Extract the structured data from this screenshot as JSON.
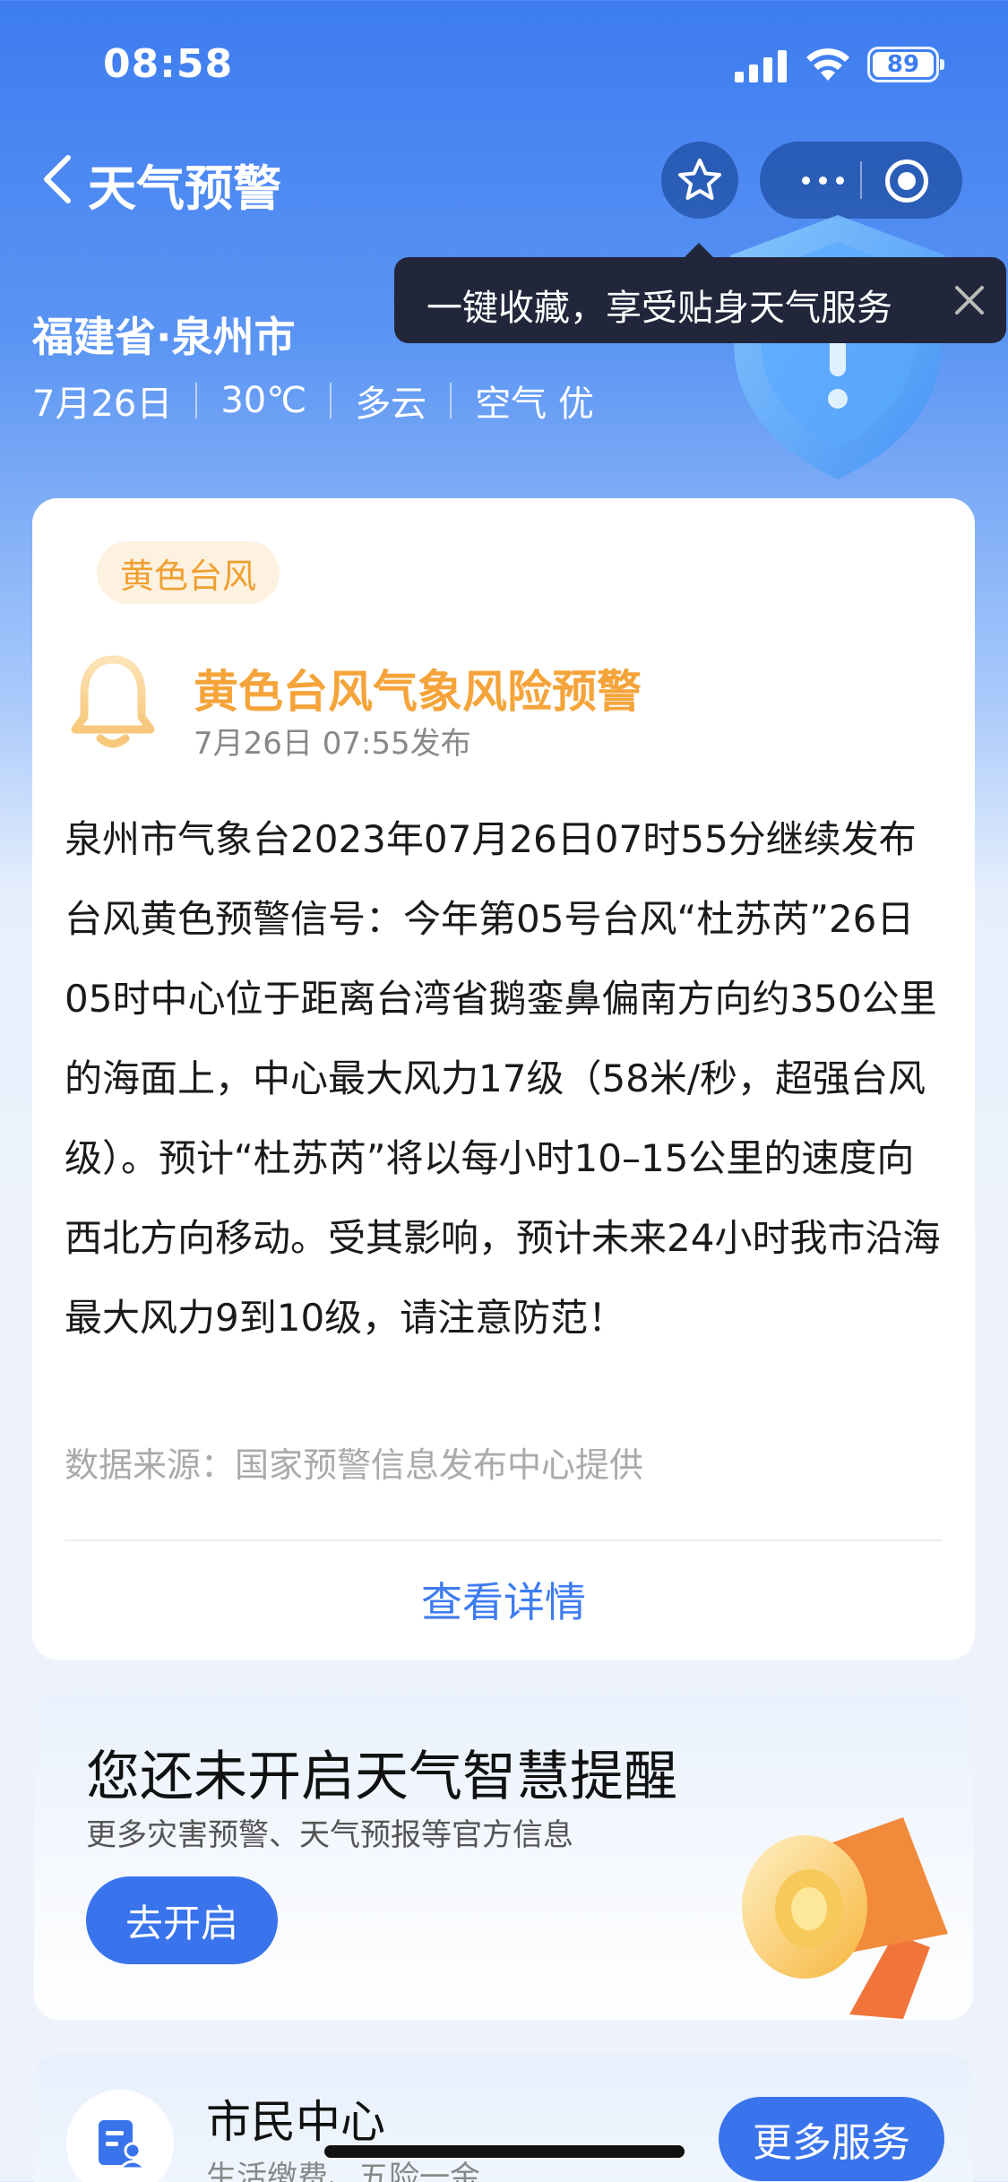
{
  "status_bar": {
    "time": "08:58",
    "battery_level": "89"
  },
  "nav": {
    "title": "天气预警"
  },
  "tooltip": {
    "text": "一键收藏，享受贴身天气服务"
  },
  "location": {
    "city": "福建省·泉州市",
    "date": "7月26日",
    "temperature": "30℃",
    "condition": "多云",
    "air_quality": "空气 优"
  },
  "warning": {
    "tag": "黄色台风",
    "title": "黄色台风气象风险预警",
    "published": "7月26日 07:55发布",
    "body": "泉州市气象台2023年07月26日07时55分继续发布台风黄色预警信号：今年第05号台风“杜苏芮”26日05时中心位于距离台湾省鹅銮鼻偏南方向约350公里的海面上，中心最大风力17级（58米/秒，超强台风级）。预计“杜苏芮”将以每小时10–15公里的速度向西北方向移动。受其影响，预计未来24小时我市沿海最大风力9到10级，请注意防范！",
    "source": "数据来源：国家预警信息发布中心提供",
    "details_link": "查看详情"
  },
  "reminder": {
    "title": "您还未开启天气智慧提醒",
    "subtitle": "更多灾害预警、天气预报等官方信息",
    "button": "去开启"
  },
  "citizen": {
    "title": "市民中心",
    "subtitle": "生活缴费、五险一金...",
    "button": "更多服务"
  },
  "colors": {
    "accent": "#3a74ec",
    "warning": "#f5a43a",
    "tooltip_bg": "#21263b"
  }
}
